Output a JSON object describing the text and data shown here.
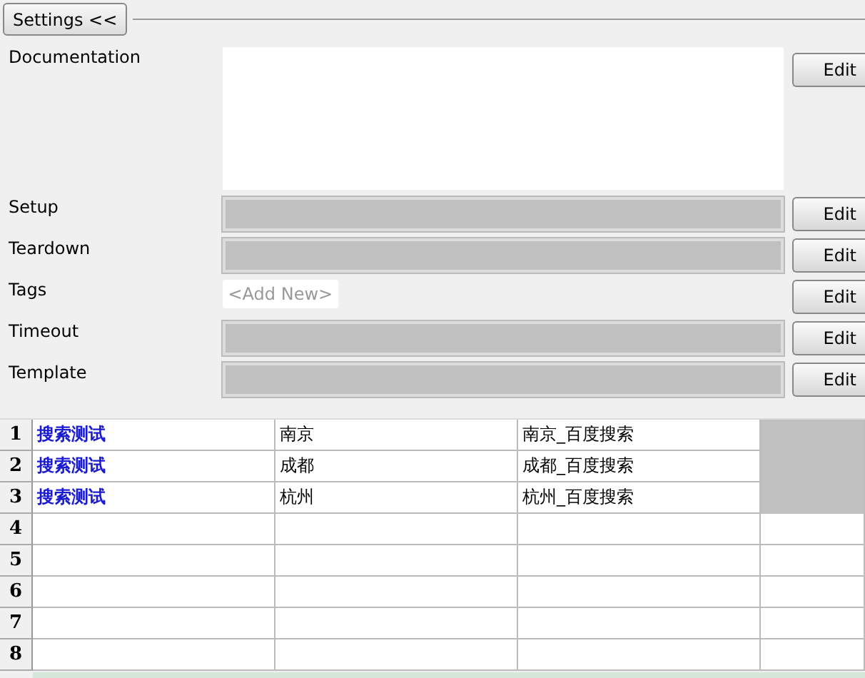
{
  "settings_toggle": {
    "label": "Settings <<"
  },
  "fields": [
    {
      "label": "Documentation",
      "kind": "textarea",
      "button": "Edit"
    },
    {
      "label": "Setup",
      "kind": "disabled",
      "button": "Edit"
    },
    {
      "label": "Teardown",
      "kind": "disabled",
      "button": "Edit"
    },
    {
      "label": "Tags",
      "kind": "tags",
      "placeholder": "<Add New>",
      "button": "Edit"
    },
    {
      "label": "Timeout",
      "kind": "disabled",
      "button": "Edit"
    },
    {
      "label": "Template",
      "kind": "disabled",
      "button": "Edit"
    }
  ],
  "grid": {
    "rows": [
      {
        "number": "1",
        "cells": [
          {
            "text": "搜索测试",
            "kind": "keyword",
            "disabled": false
          },
          {
            "text": "南京",
            "kind": "plain",
            "disabled": false
          },
          {
            "text": "南京_百度搜索",
            "kind": "plain",
            "disabled": false
          },
          {
            "disabled": true
          }
        ]
      },
      {
        "number": "2",
        "cells": [
          {
            "text": "搜索测试",
            "kind": "keyword",
            "disabled": false
          },
          {
            "text": "成都",
            "kind": "plain",
            "disabled": false
          },
          {
            "text": "成都_百度搜索",
            "kind": "plain",
            "disabled": false
          },
          {
            "disabled": true
          }
        ]
      },
      {
        "number": "3",
        "cells": [
          {
            "text": "搜索测试",
            "kind": "keyword",
            "disabled": false
          },
          {
            "text": "杭州",
            "kind": "plain",
            "disabled": false
          },
          {
            "text": "杭州_百度搜索",
            "kind": "plain",
            "disabled": false
          },
          {
            "disabled": true
          }
        ]
      },
      {
        "number": "4",
        "cells": [
          {
            "disabled": false
          },
          {
            "disabled": false
          },
          {
            "disabled": false
          },
          {
            "disabled": false
          }
        ]
      },
      {
        "number": "5",
        "cells": [
          {
            "disabled": false
          },
          {
            "disabled": false
          },
          {
            "disabled": false
          },
          {
            "disabled": false
          }
        ]
      },
      {
        "number": "6",
        "cells": [
          {
            "disabled": false
          },
          {
            "disabled": false
          },
          {
            "disabled": false
          },
          {
            "disabled": false
          }
        ]
      },
      {
        "number": "7",
        "cells": [
          {
            "disabled": false
          },
          {
            "disabled": false
          },
          {
            "disabled": false
          },
          {
            "disabled": false
          }
        ]
      },
      {
        "number": "8",
        "cells": [
          {
            "disabled": false
          },
          {
            "disabled": false
          },
          {
            "disabled": false
          },
          {
            "disabled": false
          }
        ]
      }
    ]
  }
}
